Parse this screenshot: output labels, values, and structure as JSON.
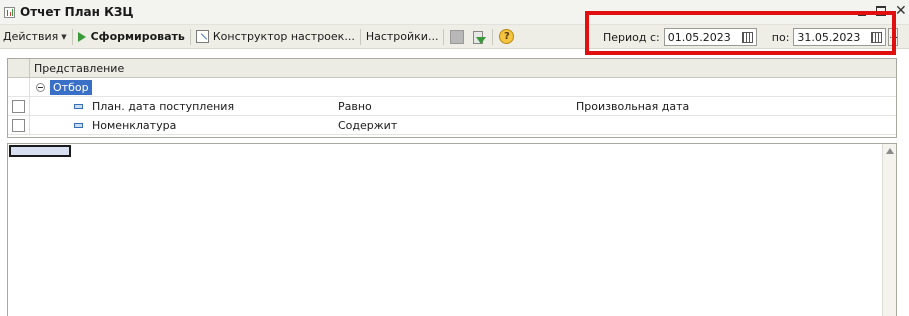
{
  "window": {
    "title": "Отчет  План КЗЦ"
  },
  "toolbar": {
    "actions_label": "Действия",
    "generate_label": "Сформировать",
    "constructor_label": "Конструктор настроек...",
    "settings_label": "Настройки...",
    "help_glyph": "?"
  },
  "period": {
    "from_label": "Период с:",
    "from_value": "01.05.2023",
    "to_label": "по:",
    "to_value": "31.05.2023",
    "select_glyph": "..."
  },
  "settings_table": {
    "column_header": "Представление",
    "group_label": "Отбор",
    "rows": [
      {
        "field": "План. дата поступления",
        "condition": "Равно",
        "value": "Произвольная дата"
      },
      {
        "field": "Номенклатура",
        "condition": "Содержит",
        "value": ""
      }
    ]
  },
  "colors": {
    "highlight_box": "#e01010",
    "selection": "#3a6fc8",
    "generate_icon": "#3a9a3a"
  },
  "icons": {
    "window": "report-icon",
    "generate": "play-icon",
    "constructor": "constructor-icon",
    "help": "help-icon",
    "calendar": "calendar-icon"
  }
}
